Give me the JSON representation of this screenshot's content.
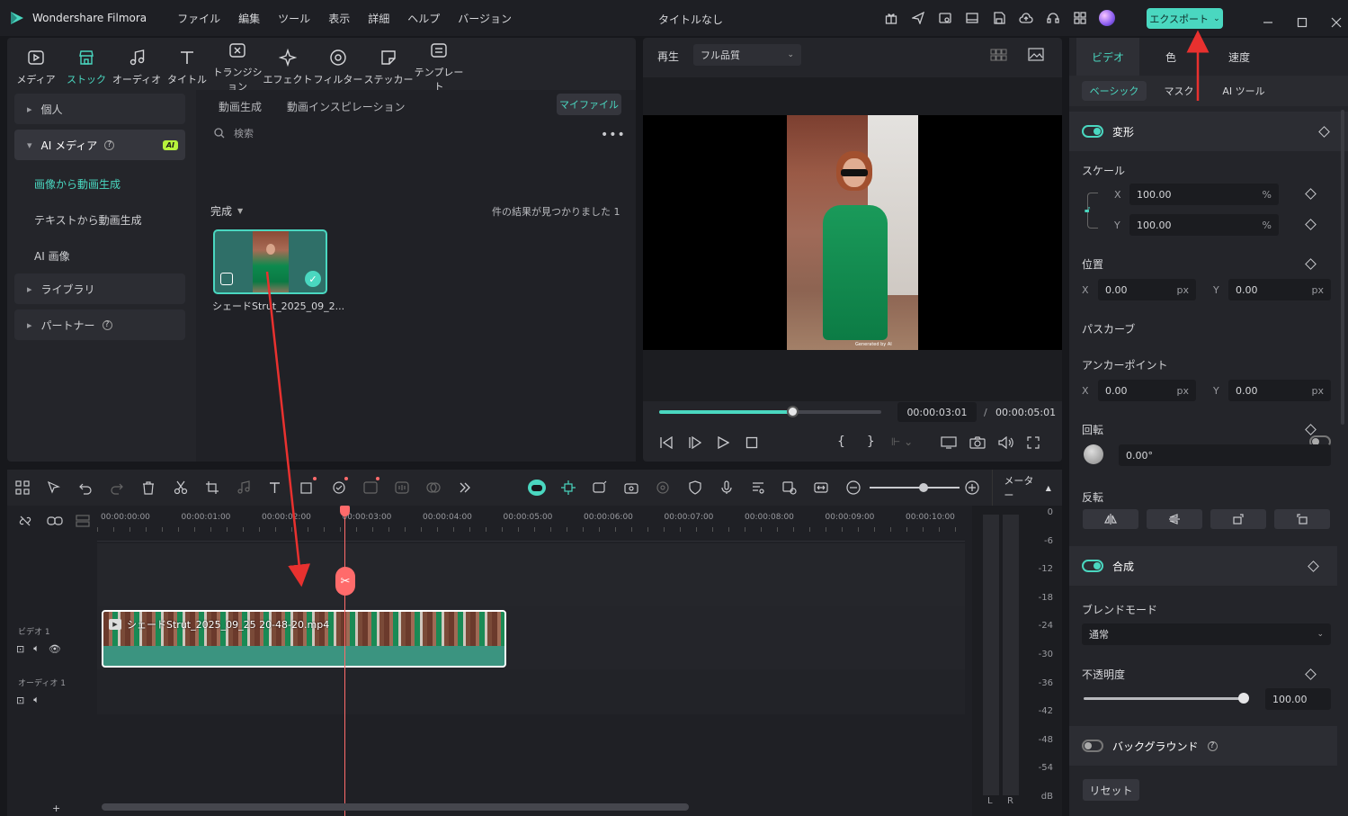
{
  "app": {
    "name": "Wondershare Filmora",
    "title": "タイトルなし",
    "export_label": "エクスポート"
  },
  "menu": [
    "ファイル",
    "編集",
    "ツール",
    "表示",
    "詳細",
    "ヘルプ",
    "バージョン"
  ],
  "toolbar": [
    "メディア",
    "ストック",
    "オーディオ",
    "タイトル",
    "トランジション",
    "エフェクト",
    "フィルター",
    "ステッカー",
    "テンプレート"
  ],
  "sidebar": {
    "personal": "個人",
    "ai_media": "AI メディア",
    "ai_badge": "AI",
    "img_to_video": "画像から動画生成",
    "text_to_video": "テキストから動画生成",
    "ai_image": "AI 画像",
    "library": "ライブラリ",
    "partner": "パートナー"
  },
  "media": {
    "tab_generate": "動画生成",
    "tab_inspiration": "動画インスピレーション",
    "my_files": "マイファイル",
    "search_placeholder": "検索",
    "done_label": "完成",
    "results": "件の結果が見つかりました 1",
    "clip_name": "シェードStrut_2025_09_2..."
  },
  "player": {
    "play_label": "再生",
    "quality": "フル品質",
    "current_time": "00:00:03:01",
    "separator": "/",
    "total_time": "00:00:05:01",
    "progress": 0.6,
    "watermark": "Generated by AI"
  },
  "timeline": {
    "meter_label": "メーター",
    "ruler": [
      "00:00:00:00",
      "00:00:01:00",
      "00:00:02:00",
      "00:00:03:00",
      "00:00:04:00",
      "00:00:05:00",
      "00:00:06:00",
      "00:00:07:00",
      "00:00:08:00",
      "00:00:09:00",
      "00:00:10:00"
    ],
    "video_track": "ビデオ 1",
    "audio_track": "オーディオ 1",
    "clip_title": "シェードStrut_2025_09_25 20-48-20.mp4",
    "db_scale": [
      "0",
      "-6",
      "-12",
      "-18",
      "-24",
      "-30",
      "-36",
      "-42",
      "-48",
      "-54",
      "dB"
    ],
    "meter_lr": [
      "L",
      "R"
    ]
  },
  "inspector": {
    "tabs": [
      "ビデオ",
      "色",
      "速度"
    ],
    "subtabs": [
      "ベーシック",
      "マスク",
      "AI ツール"
    ],
    "transform": "変形",
    "scale": "スケール",
    "scale_x": "100.00",
    "scale_y": "100.00",
    "pct": "%",
    "position": "位置",
    "pos_x": "0.00",
    "pos_y": "0.00",
    "px": "px",
    "path_curve": "パスカーブ",
    "anchor": "アンカーポイント",
    "anchor_x": "0.00",
    "anchor_y": "0.00",
    "rotate": "回転",
    "rotate_val": "0.00°",
    "flip": "反転",
    "composite": "合成",
    "blend_mode": "ブレンドモード",
    "blend_val": "通常",
    "opacity": "不透明度",
    "opacity_val": "100.00",
    "background": "バックグラウンド",
    "reset": "リセット",
    "x": "X",
    "y": "Y"
  },
  "colors": {
    "accent": "#4ad7c0",
    "playhead": "#ff6b6b",
    "annotation": "#e8312f"
  }
}
